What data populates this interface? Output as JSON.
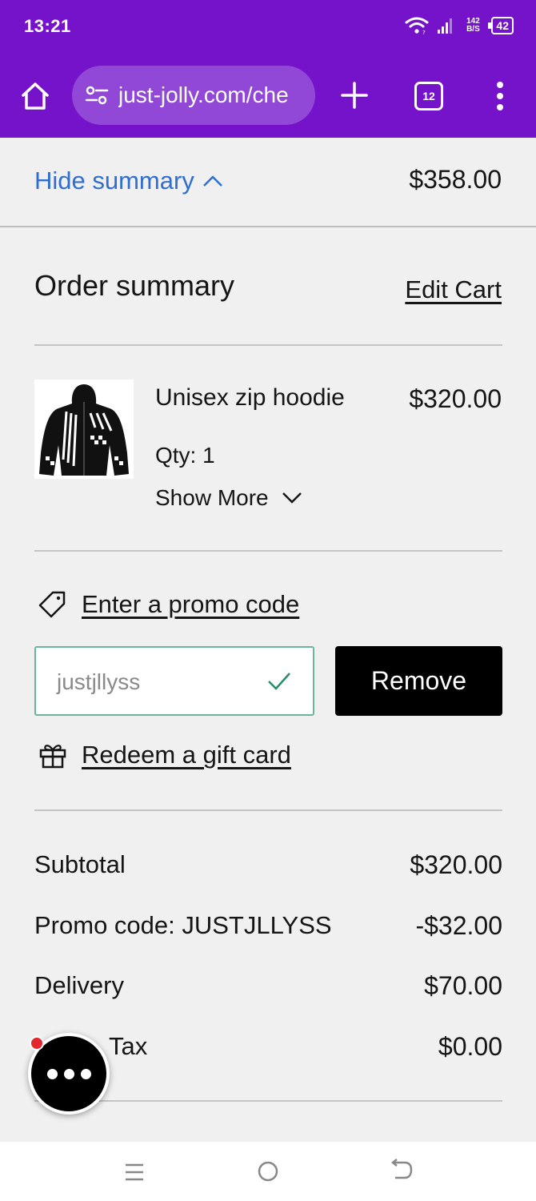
{
  "status_bar": {
    "time": "13:21",
    "net_speed_top": "142",
    "net_speed_bottom": "B/S",
    "battery": "42"
  },
  "browser": {
    "url": "just-jolly.com/che",
    "tab_count": "12",
    "accent_color": "#7413c9"
  },
  "summary_toggle": {
    "label": "Hide summary",
    "total": "$358.00"
  },
  "order_summary": {
    "title": "Order summary",
    "edit_cart": "Edit Cart"
  },
  "product": {
    "name": "Unisex zip hoodie",
    "price": "$320.00",
    "qty": "Qty: 1",
    "show_more": "Show More"
  },
  "promo": {
    "link": "Enter a promo code",
    "input_value": "justjllyss",
    "remove": "Remove",
    "gift_link": "Redeem a gift card"
  },
  "totals": [
    {
      "label": "Subtotal",
      "value": "$320.00"
    },
    {
      "label": "Promo code: JUSTJLLYSS",
      "value": "-$32.00"
    },
    {
      "label": "Delivery",
      "value": "$70.00"
    },
    {
      "label": "Tax",
      "value": "$0.00"
    }
  ]
}
